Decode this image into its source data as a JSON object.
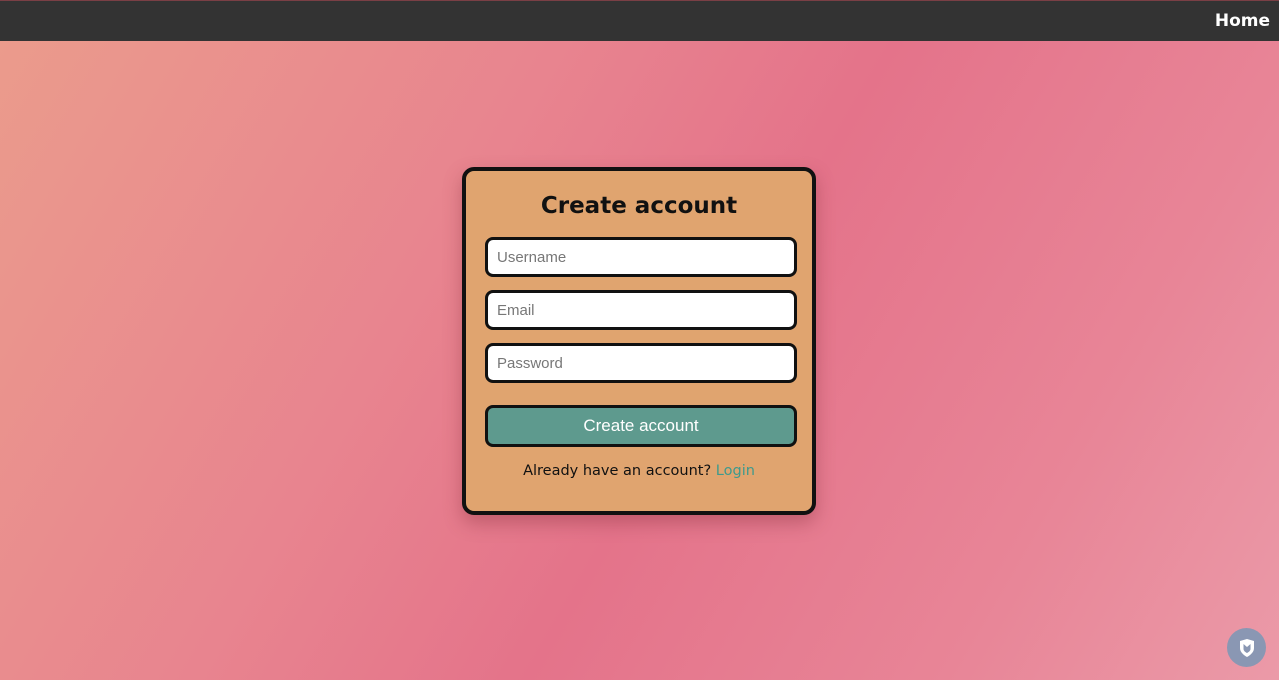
{
  "nav": {
    "home_label": "Home"
  },
  "form": {
    "title": "Create account",
    "username_placeholder": "Username",
    "email_placeholder": "Email",
    "password_placeholder": "Password",
    "submit_label": "Create account",
    "footer_text": "Already have an account?",
    "login_label": "Login"
  },
  "widgets": {
    "corner_icon": "shield-icon"
  },
  "colors": {
    "topbar": "#333333",
    "card": "#e0a46f",
    "button": "#5e9a8e",
    "link": "#3f9a8c"
  }
}
